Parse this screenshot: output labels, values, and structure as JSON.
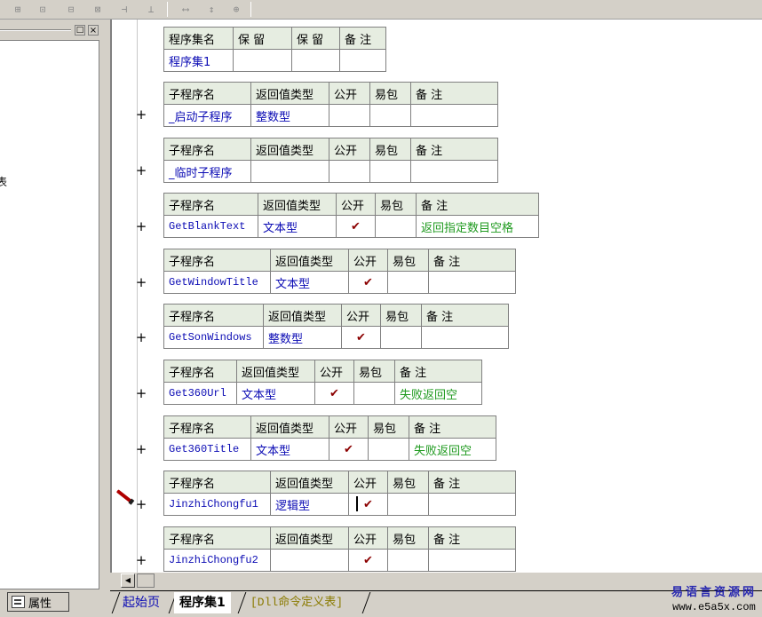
{
  "toolbar": {
    "buttons": [
      "⊞",
      "⊡",
      "⊟",
      "⊠",
      "⊣",
      "⊥",
      "⟷",
      "↕",
      "⊕"
    ]
  },
  "left_panel": {
    "min_glyph": "□",
    "close_glyph": "×",
    "cut_text": "表"
  },
  "properties_tab": {
    "label": "属性"
  },
  "program_set": {
    "headers": [
      "程序集名",
      "保 留",
      "保 留",
      "备 注"
    ],
    "values": [
      "程序集1",
      "",
      "",
      ""
    ]
  },
  "sub_header": [
    "子程序名",
    "返回值类型",
    "公开",
    "易包",
    "备 注"
  ],
  "subroutines": [
    {
      "name": "_启动子程序",
      "type": "整数型",
      "public": "",
      "easy": "",
      "note": ""
    },
    {
      "name": "_临时子程序",
      "type": "",
      "public": "",
      "easy": "",
      "note": ""
    },
    {
      "name": "GetBlankText",
      "type": "文本型",
      "public": "✔",
      "easy": "",
      "note": "返回指定数目空格"
    },
    {
      "name": "GetWindowTitle",
      "type": "文本型",
      "public": "✔",
      "easy": "",
      "note": ""
    },
    {
      "name": "GetSonWindows",
      "type": "整数型",
      "public": "✔",
      "easy": "",
      "note": ""
    },
    {
      "name": "Get360Url",
      "type": "文本型",
      "public": "✔",
      "easy": "",
      "note": "失败返回空"
    },
    {
      "name": "Get360Title",
      "type": "文本型",
      "public": "✔",
      "easy": "",
      "note": "失败返回空"
    },
    {
      "name": "JinzhiChongfu1",
      "type": "逻辑型",
      "public": "✔",
      "easy": "",
      "note": ""
    },
    {
      "name": "JinzhiChongfu2",
      "type": "",
      "public": "✔",
      "easy": "",
      "note": ""
    }
  ],
  "expand_glyph": "+",
  "scroll_left_glyph": "◀",
  "tabs": [
    "起始页",
    "程序集1",
    "[Dll命令定义表]"
  ],
  "watermark": {
    "line1": "易语言资源网",
    "line2": "www.e5a5x.com"
  },
  "colors": {
    "header_bg": "#e6ede1",
    "value_text": "#0b0bb4",
    "note_text": "#1f9a1f",
    "check_mark": "#8b0000"
  }
}
